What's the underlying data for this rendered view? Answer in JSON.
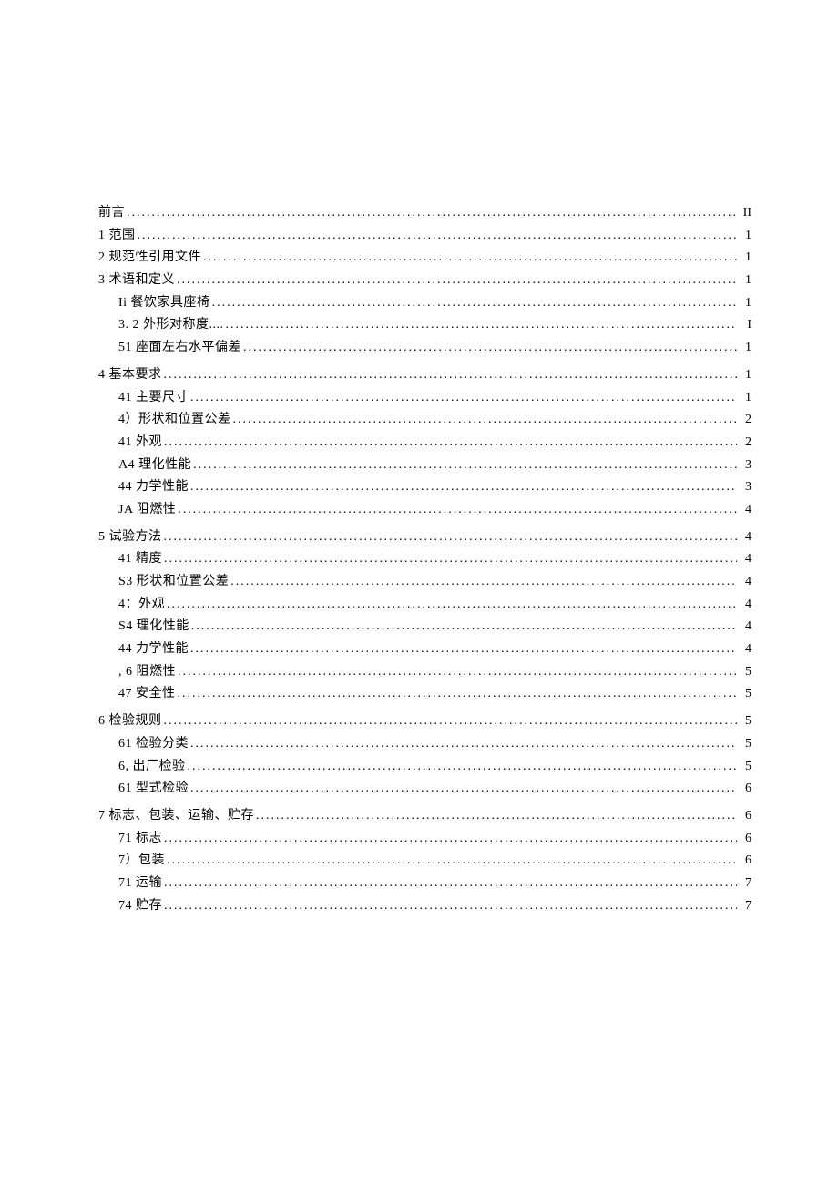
{
  "toc": [
    {
      "level": 0,
      "label": "前言",
      "page": "II",
      "gap_after": false
    },
    {
      "level": 0,
      "label": "1 范围",
      "page": "1",
      "gap_after": false
    },
    {
      "level": 0,
      "label": "2 规范性引用文件",
      "page": "1",
      "gap_after": false
    },
    {
      "level": 0,
      "label": "3 术语和定义",
      "page": "1",
      "gap_after": false
    },
    {
      "level": 1,
      "label": "Ii 餐饮家具座椅",
      "page": "1",
      "gap_after": false
    },
    {
      "level": 1,
      "label": "3. 2 外形对称度....",
      "page": "I",
      "gap_after": false
    },
    {
      "level": 1,
      "label": "51 座面左右水平偏差",
      "page": "1",
      "gap_after": true
    },
    {
      "level": 0,
      "label": "4 基本要求",
      "page": "1",
      "gap_after": false
    },
    {
      "level": 1,
      "label": "41 主要尺寸",
      "page": "1",
      "gap_after": false
    },
    {
      "level": 1,
      "label": "4）形状和位置公差",
      "page": "2",
      "gap_after": false
    },
    {
      "level": 1,
      "label": "41 外观",
      "page": "2",
      "gap_after": false
    },
    {
      "level": 1,
      "label": "A4 理化性能",
      "page": "3",
      "gap_after": false
    },
    {
      "level": 1,
      "label": "44 力学性能",
      "page": "3",
      "gap_after": false
    },
    {
      "level": 1,
      "label": "JA 阻燃性",
      "page": "4",
      "gap_after": true
    },
    {
      "level": 0,
      "label": "5 试验方法",
      "page": "4",
      "gap_after": false
    },
    {
      "level": 1,
      "label": "41 精度",
      "page": "4",
      "gap_after": false
    },
    {
      "level": 1,
      "label": "S3 形状和位置公差",
      "page": "4",
      "gap_after": false
    },
    {
      "level": 1,
      "label": "4：外观",
      "page": "4",
      "gap_after": false
    },
    {
      "level": 1,
      "label": "S4 理化性能",
      "page": "4",
      "gap_after": false
    },
    {
      "level": 1,
      "label": "44 力学性能",
      "page": "4",
      "gap_after": false
    },
    {
      "level": 1,
      "label": ", 6 阻燃性",
      "page": "5",
      "gap_after": false
    },
    {
      "level": 1,
      "label": "47 安全性",
      "page": "5",
      "gap_after": true
    },
    {
      "level": 0,
      "label": "6 检验规则",
      "page": "5",
      "gap_after": false
    },
    {
      "level": 1,
      "label": "61 检验分类",
      "page": "5",
      "gap_after": false
    },
    {
      "level": 1,
      "label": "6, 出厂检验",
      "page": "5",
      "gap_after": false
    },
    {
      "level": 1,
      "label": "61 型式检验",
      "page": "6",
      "gap_after": true
    },
    {
      "level": 0,
      "label": "7 标志、包装、运输、贮存",
      "page": "6",
      "gap_after": false
    },
    {
      "level": 1,
      "label": "71 标志",
      "page": "6",
      "gap_after": false
    },
    {
      "level": 1,
      "label": "7）包装",
      "page": "6",
      "gap_after": false
    },
    {
      "level": 1,
      "label": "71 运输",
      "page": "7",
      "gap_after": false
    },
    {
      "level": 1,
      "label": "74 贮存",
      "page": "7",
      "gap_after": false
    }
  ]
}
